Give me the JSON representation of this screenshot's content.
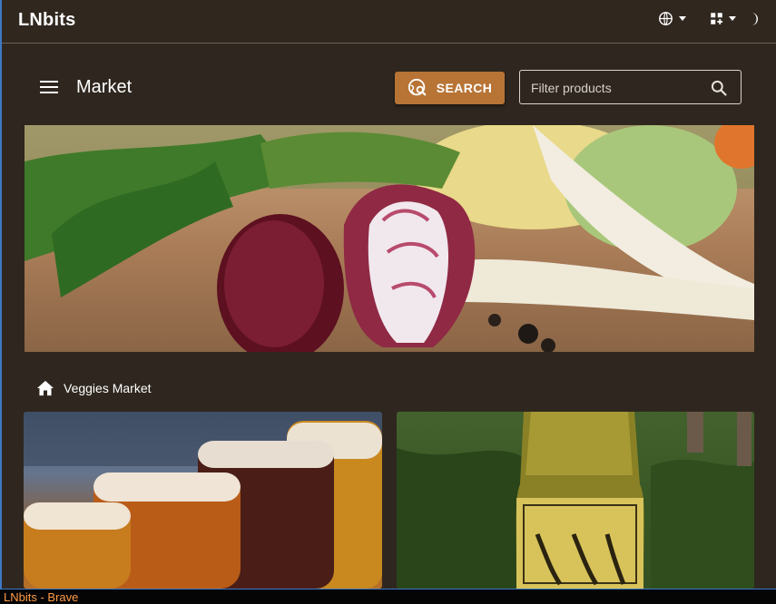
{
  "app": {
    "brand": "LNbits"
  },
  "header": {
    "language_icon": "globe-icon",
    "grid_icon": "grid-add-icon",
    "theme_icon": "dark-mode-icon"
  },
  "toolbar": {
    "menu_icon": "menu-icon",
    "title": "Market",
    "search_label": "SEARCH",
    "search_icon": "travel-explore-icon",
    "filter_placeholder": "Filter products",
    "filter_value": ""
  },
  "breadcrumb": {
    "icon": "home-icon",
    "label": "Veggies Market"
  },
  "images": {
    "banner": "vegetables-banner",
    "products": [
      {
        "image": "beer-glasses"
      },
      {
        "image": "mead-bottle"
      }
    ]
  },
  "os": {
    "window_title": "LNbits - Brave"
  },
  "colors": {
    "background": "#2f271f",
    "accent": "#b87435",
    "status_text": "#ff9b45"
  }
}
